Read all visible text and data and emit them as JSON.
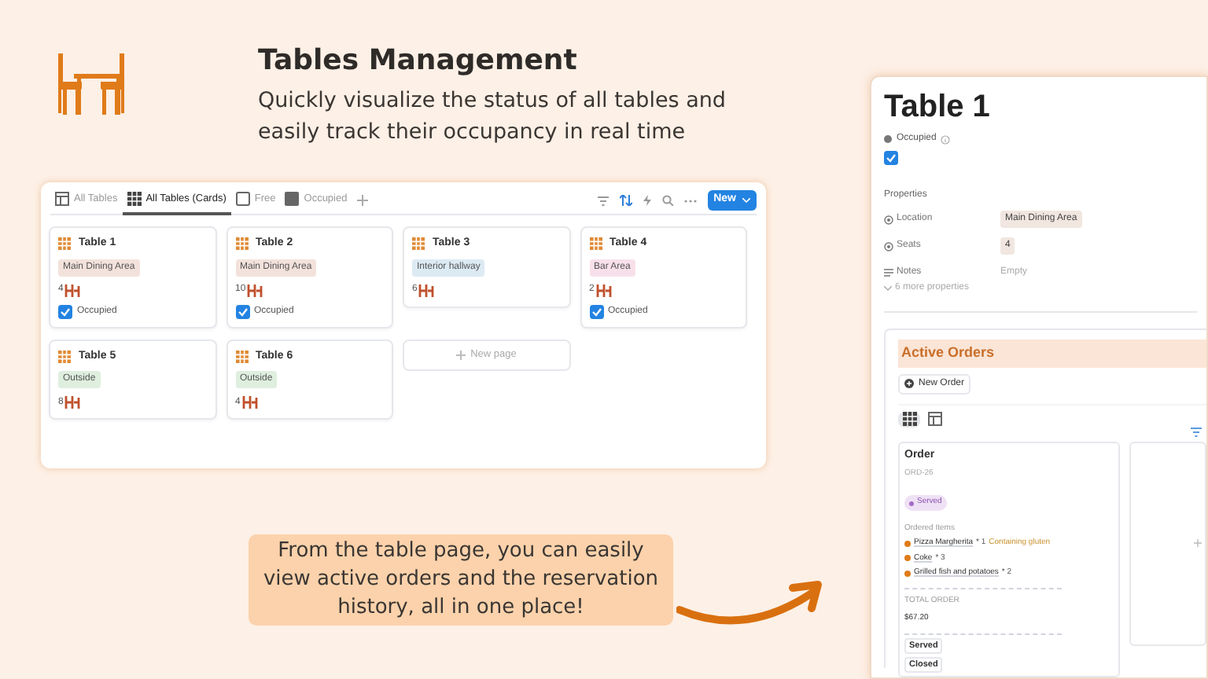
{
  "header": {
    "title": "Tables Management",
    "subtitle": "Quickly visualize the status of all tables and easily track their occupancy in real time"
  },
  "board": {
    "tabs": [
      {
        "label": "All Tables",
        "kind": "table",
        "selected": false
      },
      {
        "label": "All Tables (Cards)",
        "kind": "cards",
        "selected": true
      },
      {
        "label": "Free",
        "kind": "empty",
        "selected": false
      },
      {
        "label": "Occupied",
        "kind": "filled",
        "selected": false
      }
    ],
    "new_button": "New",
    "cards": [
      {
        "title": "Table 1",
        "location": "Main Dining Area",
        "color": "#f3e2dc",
        "seats": "4",
        "checkbox": {
          "label": "Occupied",
          "checked": true
        }
      },
      {
        "title": "Table 2",
        "location": "Main Dining Area",
        "color": "#f3e2dc",
        "seats": "10",
        "checkbox": {
          "label": "Occupied",
          "checked": true
        }
      },
      {
        "title": "Table 3",
        "location": "Interior hallway",
        "color": "#dceaf3",
        "seats": "6"
      },
      {
        "title": "Table 4",
        "location": "Bar Area",
        "color": "#f8e0ea",
        "seats": "2",
        "checkbox": {
          "label": "Occupied",
          "checked": true
        }
      },
      {
        "title": "Table 5",
        "location": "Outside",
        "color": "#dfefdf",
        "seats": "8"
      },
      {
        "title": "Table 6",
        "location": "Outside",
        "color": "#dfefdf",
        "seats": "4"
      }
    ],
    "new_page": "New page"
  },
  "detail": {
    "title": "Table 1",
    "status_label": "Occupied",
    "checked": true,
    "properties_heading": "Properties",
    "properties": [
      {
        "name": "Location",
        "kind": "tag",
        "value": "Main Dining Area"
      },
      {
        "name": "Seats",
        "kind": "tag",
        "value": "4"
      },
      {
        "name": "Notes",
        "kind": "empty",
        "value": "Empty"
      }
    ],
    "more": "6 more properties",
    "orders_heading": "Active Orders",
    "new_order": "New Order",
    "views": [
      {
        "kind": "cards",
        "selected": true
      },
      {
        "kind": "table",
        "selected": false
      }
    ],
    "order": {
      "title": "Order",
      "id": "ORD-26",
      "status": "Served",
      "items_heading": "Ordered Items",
      "items": [
        {
          "name": "Pizza Margherita",
          "qty": "* 1",
          "note": "Containing gluten"
        },
        {
          "name": "Coke",
          "qty": "* 3"
        },
        {
          "name": "Grilled fish and potatoes",
          "qty": "* 2"
        }
      ],
      "total_label": "TOTAL ORDER",
      "total": "$67.20",
      "buttons": [
        "Served",
        "Closed"
      ]
    }
  },
  "callout": "From the table page, you can easily view active orders and the reservation history, all in one place!"
}
